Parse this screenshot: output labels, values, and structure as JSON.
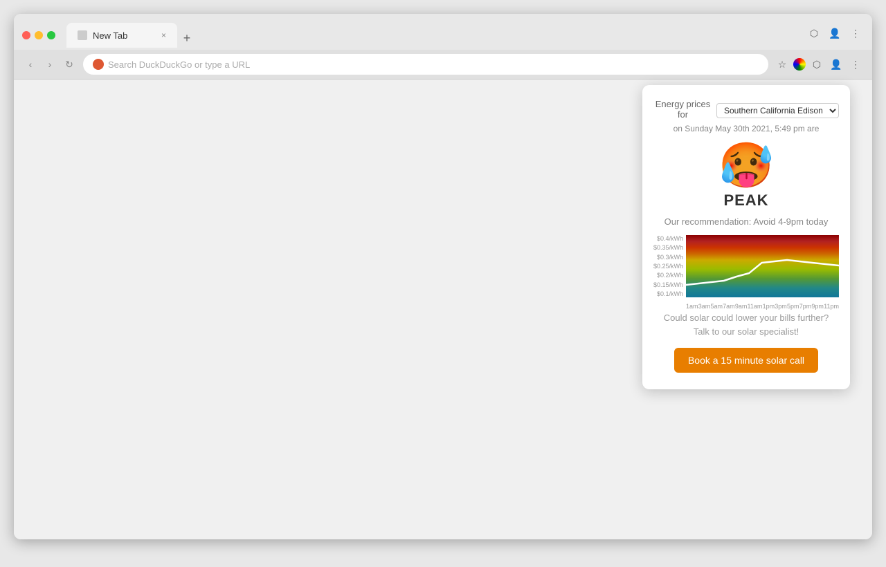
{
  "browser": {
    "tab_label": "New Tab",
    "url_placeholder": "Search DuckDuckGo or type a URL",
    "tab_close": "×",
    "tab_add": "+"
  },
  "popup": {
    "energy_prices_label": "Energy prices for",
    "utility": "Southern California Edison",
    "datetime": "on Sunday May 30th 2021, 5:49 pm are",
    "status_emoji": "🥵",
    "status_label": "PEAK",
    "recommendation": "Our recommendation: Avoid 4-9pm today",
    "solar_promo_line1": "Could solar could lower your bills further?",
    "solar_promo_line2": "Talk to our solar specialist!",
    "solar_button": "Book a 15 minute solar call",
    "chart": {
      "y_labels": [
        "$0.4/kWh",
        "$0.35/kWh",
        "$0.3/kWh",
        "$0.25/kWh",
        "$0.2/kWh",
        "$0.15/kWh",
        "$0.1/kWh"
      ],
      "x_labels": [
        "1am",
        "3am",
        "5am",
        "7am",
        "9am",
        "11am",
        "1pm",
        "3pm",
        "5pm",
        "7pm",
        "9pm",
        "11pm"
      ]
    }
  }
}
